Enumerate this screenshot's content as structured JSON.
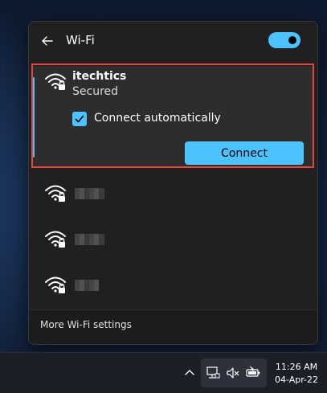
{
  "flyout": {
    "title": "Wi-Fi",
    "wifi_enabled": true,
    "selected_network": {
      "name": "itechtics",
      "status": "Secured",
      "connect_automatically_label": "Connect automatically",
      "connect_automatically_checked": true,
      "connect_button_label": "Connect"
    },
    "other_networks_count": 3,
    "footer_link": "More Wi-Fi settings"
  },
  "taskbar": {
    "time": "11:26 AM",
    "date": "04-Apr-22"
  },
  "colors": {
    "accent": "#4cc2ff",
    "panel": "#202020",
    "highlight": "#e0483d"
  }
}
